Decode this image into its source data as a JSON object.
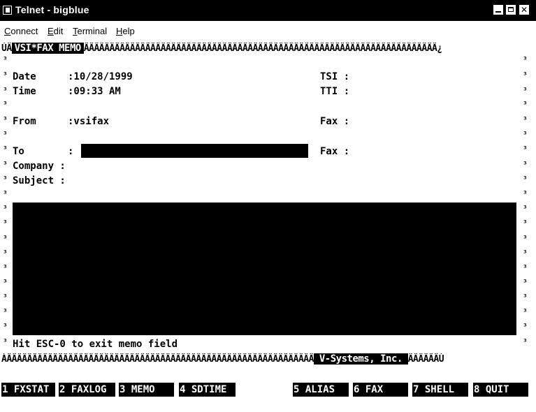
{
  "window": {
    "title": "Telnet - bigblue",
    "controls": [
      "minimize",
      "maximize",
      "close"
    ]
  },
  "menu": [
    "Connect",
    "Edit",
    "Terminal",
    "Help"
  ],
  "header": {
    "prefix": "ÚÄ",
    "title": "VSI*FAX MEMO",
    "fill": "ÄÄÄÄÄÄÄÄÄÄÄÄÄÄÄÄÄÄÄÄÄÄÄÄÄÄÄÄÄÄÄÄÄÄÄÄÄÄÄÄÄÄÄÄÄÄÄÄÄÄÄÄÄÄÄÄÄÄÄÄÄÄÄÄÄÄÄÄÄ¿"
  },
  "fields": {
    "date_label": "Date",
    "date_value": ":10/28/1999",
    "time_label": "Time",
    "time_value": ":09:33 AM",
    "from_label": "From",
    "from_value": ":vsifax",
    "to_label": "To",
    "to_colon": ":",
    "company_label": "Company :",
    "subject_label": "Subject :",
    "tsi_label": "TSI :",
    "tti_label": "TTI :",
    "fax_from_label": "Fax :",
    "fax_to_label": "Fax :"
  },
  "status": {
    "hint": "Hit ESC-0 to exit memo field"
  },
  "footer": {
    "fill_left": "ÀÄÄÄÄÄÄÄÄÄÄÄÄÄÄÄÄÄÄÄÄÄÄÄÄÄÄÄÄÄÄÄÄÄÄÄÄÄÄÄÄÄÄÄÄÄÄÄÄÄÄÄÄÄÄÄÄÄÄÄÄ",
    "company": " V-Systems, Inc. ",
    "fill_right": "ÄÄÄÄÄÄÙ"
  },
  "function_keys": [
    {
      "num": "1",
      "label": "FXSTAT"
    },
    {
      "num": "2",
      "label": "FAXLOG"
    },
    {
      "num": "3",
      "label": "MEMO  "
    },
    {
      "num": "4",
      "label": "SDTIME  "
    },
    {
      "num": "5",
      "label": "ALIAS "
    },
    {
      "num": "6",
      "label": "FAX   "
    },
    {
      "num": "7",
      "label": "SHELL "
    },
    {
      "num": "8",
      "label": "QUIT   "
    }
  ]
}
